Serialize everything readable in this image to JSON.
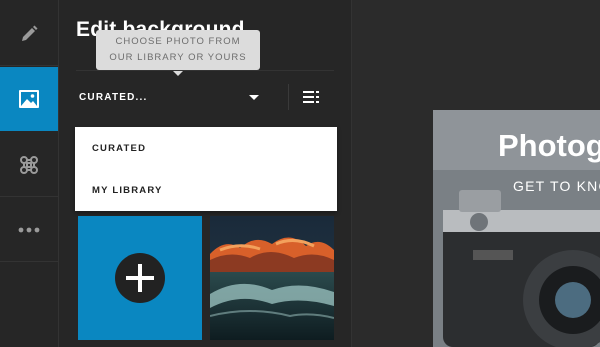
{
  "sidebar": {
    "items": [
      {
        "icon": "pencil-icon",
        "active": false
      },
      {
        "icon": "image-icon",
        "active": true
      },
      {
        "icon": "command-icon",
        "active": false
      },
      {
        "icon": "more-icon",
        "active": false
      }
    ]
  },
  "panel": {
    "title": "Edit background",
    "tooltip": {
      "line1": "CHOOSE PHOTO FROM",
      "line2": "OUR LIBRARY OR YOURS"
    },
    "select": {
      "value": "CURATED...",
      "options": [
        "CURATED",
        "MY LIBRARY"
      ]
    },
    "view_toggle_icon": "list-icon",
    "add_tile_icon": "plus-icon"
  },
  "preview": {
    "title": "Photog",
    "subtitle": "GET TO KNO"
  },
  "colors": {
    "accent": "#0a87c1",
    "panel_bg": "#262626",
    "tooltip_bg": "#dcdcdc"
  }
}
